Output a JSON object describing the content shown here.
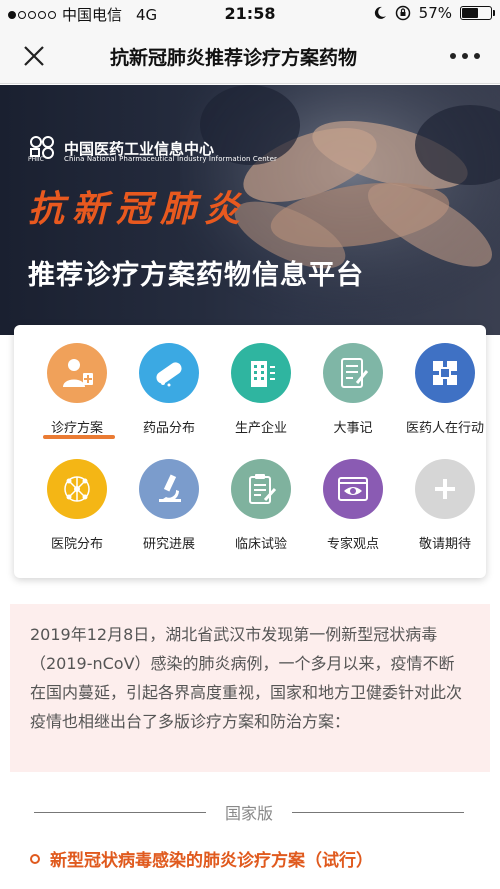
{
  "status_bar": {
    "carrier": "中国电信",
    "network": "4G",
    "time": "21:58",
    "battery_percent": "57%",
    "battery_level": 0.57
  },
  "nav": {
    "title": "抗新冠肺炎推荐诊疗方案药物",
    "close_icon": "close-icon",
    "more_icon": "more-icon"
  },
  "banner": {
    "org_name": "中国医药工业信息中心",
    "org_en": "China National Pharmaceutical Industry Information Center",
    "org_logo_text": "PHIIC",
    "title1": "抗新冠肺炎",
    "title2": "推荐诊疗方案药物信息平台"
  },
  "grid": {
    "items": [
      {
        "label": "诊疗方案",
        "icon": "doctor-icon",
        "color": "#f0a15a"
      },
      {
        "label": "药品分布",
        "icon": "pill-icon",
        "color": "#3ba9e3"
      },
      {
        "label": "生产企业",
        "icon": "building-icon",
        "color": "#2fb5a0"
      },
      {
        "label": "大事记",
        "icon": "checklist-icon",
        "color": "#7fb6a6"
      },
      {
        "label": "医药人在行动",
        "icon": "hands-icon",
        "color": "#3f71c4"
      },
      {
        "label": "医院分布",
        "icon": "network-icon",
        "color": "#f4b615"
      },
      {
        "label": "研究进展",
        "icon": "microscope-icon",
        "color": "#7b9ccc"
      },
      {
        "label": "临床试验",
        "icon": "clipboard-icon",
        "color": "#7fb29e"
      },
      {
        "label": "专家观点",
        "icon": "eye-icon",
        "color": "#8a5bb3"
      },
      {
        "label": "敬请期待",
        "icon": "plus-icon",
        "color": "#d6d6d6"
      }
    ],
    "active_index": 0
  },
  "intro": {
    "text": "2019年12月8日，湖北省武汉市发现第一例新型冠状病毒（2019-nCoV）感染的肺炎病例，一个多月以来，疫情不断在国内蔓延，引起各界高度重视，国家和地方卫健委针对此次疫情也相继出台了多版诊疗方案和防治方案："
  },
  "section": {
    "heading": "国家版",
    "first_plan": "新型冠状病毒感染的肺炎诊疗方案（试行）"
  }
}
